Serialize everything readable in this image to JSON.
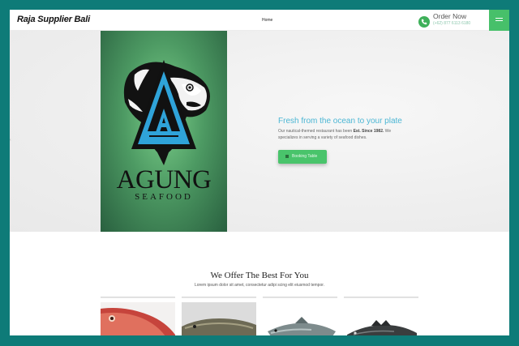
{
  "header": {
    "brand": "Raja Supplier Bali",
    "nav": {
      "home": "Home"
    },
    "order_title": "Order Now",
    "order_phone": "(+62) 877 6113 6180"
  },
  "hero": {
    "logo_title": "AGUNG",
    "logo_subtitle": "SEAFOOD",
    "headline": "Fresh from the ocean to your plate",
    "text_part1": "Our nautical-themed restaurant has been ",
    "text_bold": "Est. Since 1982.",
    "text_part2": " We specializes in serving a variety of seafood dishes.",
    "button_label": "Booking Table"
  },
  "offer": {
    "title": "We Offer The Best For You",
    "subtitle": "Lorem ipsum dolor sit amet, consectetur adipi scing elit eiusmod tempor."
  },
  "colors": {
    "frame_bg": "#0e7b78",
    "accent_green": "#47c06a",
    "headline_blue": "#4bb6d4"
  }
}
